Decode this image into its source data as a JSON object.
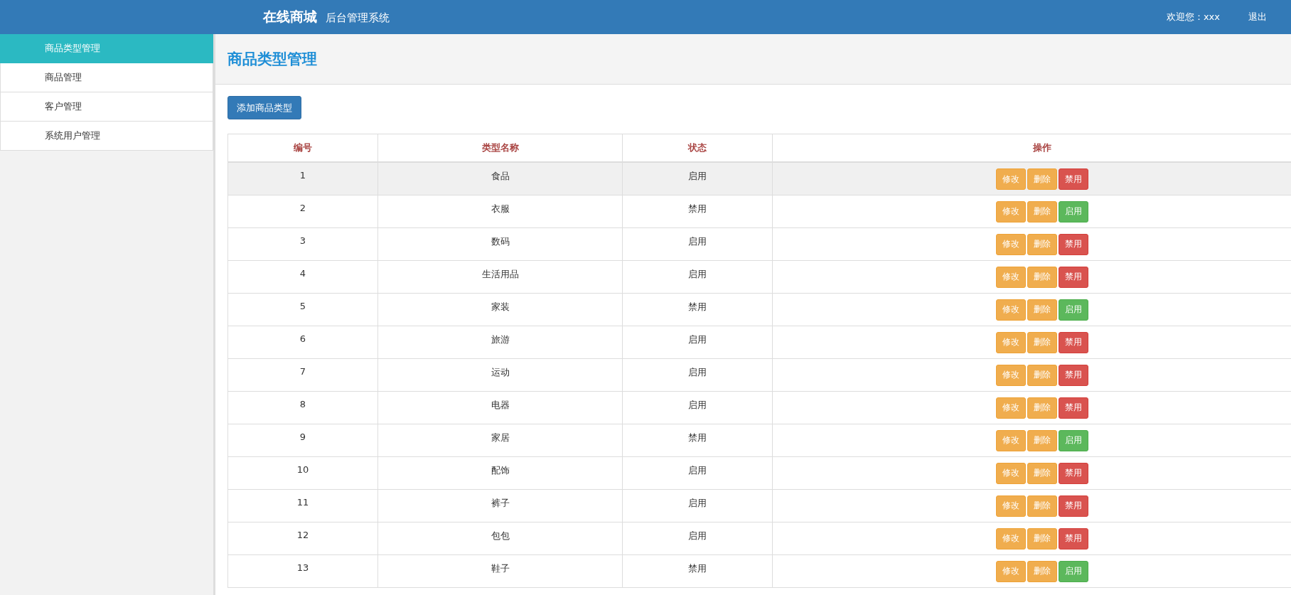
{
  "header": {
    "brand": "在线商城",
    "subtitle": "后台管理系统",
    "welcome": "欢迎您：xxx",
    "logout": "退出"
  },
  "sidebar": {
    "items": [
      {
        "label": "商品类型管理",
        "selected": true
      },
      {
        "label": "商品管理",
        "selected": false
      },
      {
        "label": "客户管理",
        "selected": false
      },
      {
        "label": "系统用户管理",
        "selected": false
      }
    ]
  },
  "page_title": "商品类型管理",
  "add_button": "添加商品类型",
  "table": {
    "columns": [
      "编号",
      "类型名称",
      "状态",
      "操作"
    ],
    "rows": [
      {
        "id": "1",
        "name": "食品",
        "status": "启用",
        "hovered": true,
        "actions": [
          {
            "label": "修改",
            "kind": "edit"
          },
          {
            "label": "删除",
            "kind": "delete"
          },
          {
            "label": "禁用",
            "kind": "disable"
          }
        ]
      },
      {
        "id": "2",
        "name": "衣服",
        "status": "禁用",
        "hovered": false,
        "actions": [
          {
            "label": "修改",
            "kind": "edit"
          },
          {
            "label": "删除",
            "kind": "delete"
          },
          {
            "label": "启用",
            "kind": "enable"
          }
        ]
      },
      {
        "id": "3",
        "name": "数码",
        "status": "启用",
        "hovered": false,
        "actions": [
          {
            "label": "修改",
            "kind": "edit"
          },
          {
            "label": "删除",
            "kind": "delete"
          },
          {
            "label": "禁用",
            "kind": "disable"
          }
        ]
      },
      {
        "id": "4",
        "name": "生活用品",
        "status": "启用",
        "hovered": false,
        "actions": [
          {
            "label": "修改",
            "kind": "edit"
          },
          {
            "label": "删除",
            "kind": "delete"
          },
          {
            "label": "禁用",
            "kind": "disable"
          }
        ]
      },
      {
        "id": "5",
        "name": "家装",
        "status": "禁用",
        "hovered": false,
        "actions": [
          {
            "label": "修改",
            "kind": "edit"
          },
          {
            "label": "删除",
            "kind": "delete"
          },
          {
            "label": "启用",
            "kind": "enable"
          }
        ]
      },
      {
        "id": "6",
        "name": "旅游",
        "status": "启用",
        "hovered": false,
        "actions": [
          {
            "label": "修改",
            "kind": "edit"
          },
          {
            "label": "删除",
            "kind": "delete"
          },
          {
            "label": "禁用",
            "kind": "disable"
          }
        ]
      },
      {
        "id": "7",
        "name": "运动",
        "status": "启用",
        "hovered": false,
        "actions": [
          {
            "label": "修改",
            "kind": "edit"
          },
          {
            "label": "删除",
            "kind": "delete"
          },
          {
            "label": "禁用",
            "kind": "disable"
          }
        ]
      },
      {
        "id": "8",
        "name": "电器",
        "status": "启用",
        "hovered": false,
        "actions": [
          {
            "label": "修改",
            "kind": "edit"
          },
          {
            "label": "删除",
            "kind": "delete"
          },
          {
            "label": "禁用",
            "kind": "disable"
          }
        ]
      },
      {
        "id": "9",
        "name": "家居",
        "status": "禁用",
        "hovered": false,
        "actions": [
          {
            "label": "修改",
            "kind": "edit"
          },
          {
            "label": "删除",
            "kind": "delete"
          },
          {
            "label": "启用",
            "kind": "enable"
          }
        ]
      },
      {
        "id": "10",
        "name": "配饰",
        "status": "启用",
        "hovered": false,
        "actions": [
          {
            "label": "修改",
            "kind": "edit"
          },
          {
            "label": "删除",
            "kind": "delete"
          },
          {
            "label": "禁用",
            "kind": "disable"
          }
        ]
      },
      {
        "id": "11",
        "name": "裤子",
        "status": "启用",
        "hovered": false,
        "actions": [
          {
            "label": "修改",
            "kind": "edit"
          },
          {
            "label": "删除",
            "kind": "delete"
          },
          {
            "label": "禁用",
            "kind": "disable"
          }
        ]
      },
      {
        "id": "12",
        "name": "包包",
        "status": "启用",
        "hovered": false,
        "actions": [
          {
            "label": "修改",
            "kind": "edit"
          },
          {
            "label": "删除",
            "kind": "delete"
          },
          {
            "label": "禁用",
            "kind": "disable"
          }
        ]
      },
      {
        "id": "13",
        "name": "鞋子",
        "status": "禁用",
        "hovered": false,
        "actions": [
          {
            "label": "修改",
            "kind": "edit"
          },
          {
            "label": "删除",
            "kind": "delete"
          },
          {
            "label": "启用",
            "kind": "enable"
          }
        ]
      }
    ]
  }
}
